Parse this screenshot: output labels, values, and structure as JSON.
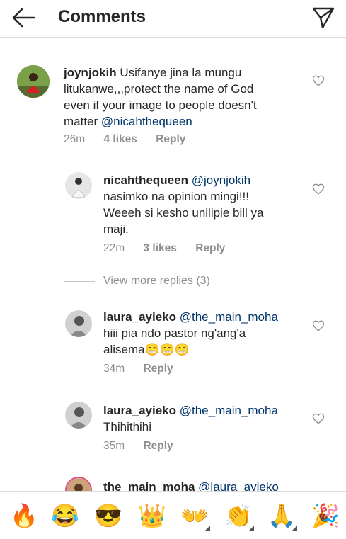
{
  "header": {
    "title": "Comments",
    "back_icon": "arrow-left-icon",
    "send_icon": "paper-plane-icon"
  },
  "comments": [
    {
      "username": "joynjokih",
      "text": "Usifanye jina la mungu litukanwe,,,protect the name of God even if your image to people doesn't matter",
      "line1": "Usifanye jina la mungu",
      "line2": "litukanwe,,,protect the name of God",
      "line3": "even if your image to people doesn't",
      "line4a": "matter",
      "mention": "@nicahthequeen",
      "time": "26m",
      "likes": "4 likes",
      "reply": "Reply"
    },
    {
      "username": "nicahthequeen",
      "mention": "@joynjokih",
      "line2": "nasimko na opinion mingi!!!",
      "line3": "Weeeh si kesho unilipie bill ya",
      "line4": "maji.",
      "time": "22m",
      "likes": "3 likes",
      "reply": "Reply"
    },
    {
      "username": "laura_ayieko",
      "mention": "@the_main_moha",
      "line2": "hiii pia ndo  pastor ng'ang'a",
      "line3": "alisema😁😁😁",
      "time": "34m",
      "reply": "Reply"
    },
    {
      "username": "laura_ayieko",
      "mention": "@the_main_moha",
      "line2": "Thihithihi",
      "time": "35m",
      "reply": "Reply"
    },
    {
      "username": "the_main_moha",
      "mention": "@laura_ayieko"
    }
  ],
  "view_more": "View more replies (3)",
  "emoji_bar": [
    "🔥",
    "😂",
    "😎",
    "👑",
    "👐",
    "👏",
    "🙏",
    "🎉"
  ]
}
